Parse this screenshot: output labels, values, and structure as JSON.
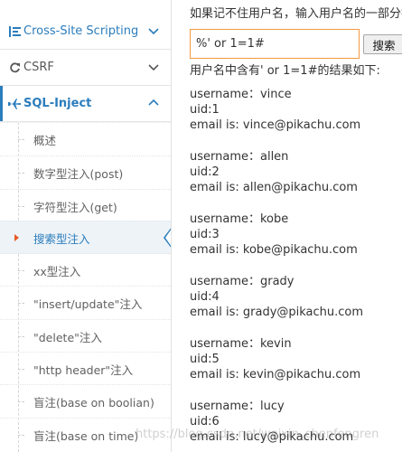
{
  "sidebar": {
    "menus": [
      {
        "label": "Cross-Site Scripting",
        "icon": "list-icon",
        "expanded": false
      },
      {
        "label": "CSRF",
        "icon": "refresh-icon",
        "expanded": false
      },
      {
        "label": "SQL-Inject",
        "icon": "plane-icon",
        "expanded": true
      }
    ],
    "sql_items": [
      {
        "label": "概述"
      },
      {
        "label": "数字型注入(post)"
      },
      {
        "label": "字符型注入(get)"
      },
      {
        "label": "搜索型注入",
        "active": true
      },
      {
        "label": "xx型注入"
      },
      {
        "label": "\"insert/update\"注入"
      },
      {
        "label": "\"delete\"注入"
      },
      {
        "label": "\"http header\"注入"
      },
      {
        "label": "盲注(base on boolian)"
      },
      {
        "label": "盲注(base on time)"
      }
    ]
  },
  "main": {
    "hint": "如果记不住用户名，输入用户名的一部分搜索的试试看？",
    "search_value": "%' or 1=1#",
    "search_button": "搜索",
    "result_title": "用户名中含有' or 1=1#的结果如下:",
    "results": [
      {
        "username": "username：vince",
        "uid": "uid:1",
        "email": "email is: vince@pikachu.com"
      },
      {
        "username": "username：allen",
        "uid": "uid:2",
        "email": "email is: allen@pikachu.com"
      },
      {
        "username": "username：kobe",
        "uid": "uid:3",
        "email": "email is: kobe@pikachu.com"
      },
      {
        "username": "username：grady",
        "uid": "uid:4",
        "email": "email is: grady@pikachu.com"
      },
      {
        "username": "username：kevin",
        "uid": "uid:5",
        "email": "email is: kevin@pikachu.com"
      },
      {
        "username": "username：lucy",
        "uid": "uid:6",
        "email": "email is: lucy@pikachu.com"
      }
    ]
  },
  "watermark": "https://blog.csdn.net/weixin_chenfengren",
  "colors": {
    "accent": "#2b7dbc",
    "input_border": "#f59942",
    "active_marker": "#e55a24"
  }
}
